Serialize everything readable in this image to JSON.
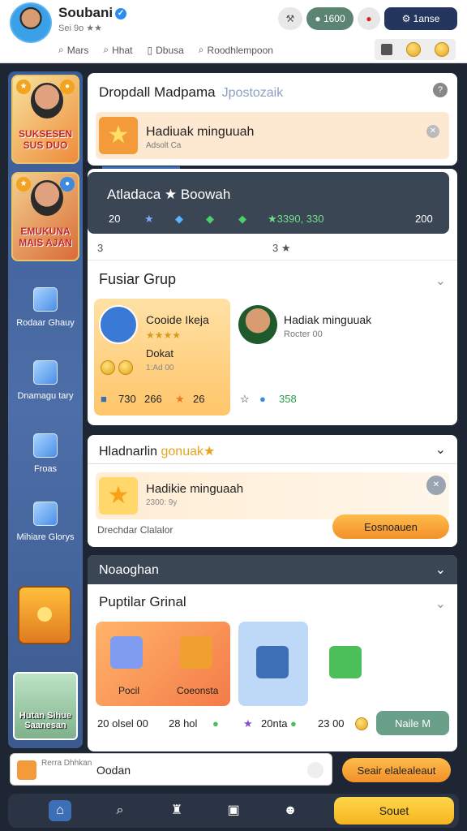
{
  "header": {
    "username": "Soubani",
    "subtitle": "Sei 9o ★★",
    "btn_tool_icon": "hammer-icon",
    "btn_coins": "● 1600",
    "btn_alert_icon": "alert-icon",
    "btn_premium": "⚙ 1anse",
    "tabs": [
      {
        "label": "Mars",
        "icon": "search-icon"
      },
      {
        "label": "Hhat",
        "icon": "search-icon"
      },
      {
        "label": "Dbusa",
        "icon": "book-icon"
      },
      {
        "label": "Roodhlempoon",
        "icon": "search-icon"
      }
    ]
  },
  "sidebar": {
    "promo1_text": "SUKSESEN SUS DUO",
    "promo2_text": "EMUKUNA MAIS AJAN",
    "items": [
      {
        "label": "Rodaar Ghauy"
      },
      {
        "label": "Dnamagu tary"
      },
      {
        "label": "Froas"
      },
      {
        "label": "Mihiare Glorys"
      }
    ],
    "photo_text": "Hutan Sihue Saanesan"
  },
  "card1": {
    "title": "Dropdall Madpama",
    "title_hint": "Jpostozaik",
    "notice_title": "Hadiuak minguuah",
    "notice_sub": "Adsolt Ca"
  },
  "card2": {
    "bar_title": "Atladaca ★ Boowah",
    "stat_left": "20",
    "stat_mid": "★3390, 330",
    "stat_right": "200",
    "row_left": "3",
    "row_mid": "3 ★",
    "section_title": "Fusiar Grup",
    "card_a": {
      "title": "Cooide Ikeja",
      "stars": "★★★★",
      "label": "Dokat",
      "sub": "1:Ad 00"
    },
    "card_b": {
      "title": "Hadiak minguuak",
      "sub": "Rocter 00"
    },
    "foot": {
      "a": "730",
      "b": "266",
      "c": "26",
      "d": "358"
    }
  },
  "card3": {
    "header_title": "Hladnarlin",
    "header_highlight": "gonuak★",
    "notice_title": "Hadikie minguaah",
    "notice_sub": "2300: 9y",
    "footer_text": "Drechdar Clalalor",
    "button": "Eosnoauen"
  },
  "card4": {
    "header_title": "Noaoghan",
    "section_title": "Puptilar Grinal",
    "tiles": [
      {
        "label": "Pocil"
      },
      {
        "label": "Coeonsta"
      }
    ],
    "foot": {
      "a": "20 olsel 00",
      "b": "28 hol",
      "c": "20nta",
      "d": "23 00"
    },
    "button": "Naile M"
  },
  "bottom": {
    "search_hint": "Rerra Dhhkan",
    "search_value": "Oodan",
    "search_button": "Seair elalealeaut",
    "nav_button": "Souet"
  },
  "colors": {
    "accent": "#3c6fb5",
    "orange": "#f2902a",
    "dark": "#3b4655"
  }
}
